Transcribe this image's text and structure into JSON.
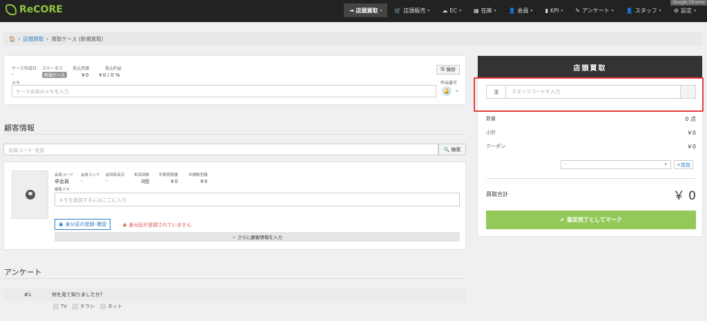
{
  "nav": {
    "brand": "ReCORE",
    "items": [
      {
        "icon": "⇥",
        "label": "店頭買取",
        "active": true
      },
      {
        "icon": "🛒",
        "label": "店頭販売"
      },
      {
        "icon": "☁",
        "label": "EC"
      },
      {
        "icon": "▦",
        "label": "在庫"
      },
      {
        "icon": "👤",
        "label": "会員"
      },
      {
        "icon": "▮",
        "label": "KPI"
      },
      {
        "icon": "✎",
        "label": "アンケート"
      },
      {
        "icon": "👤",
        "label": "スタッフ"
      },
      {
        "icon": "⚙",
        "label": "設定"
      }
    ],
    "chrome_label": "Google Chrome"
  },
  "breadcrumb": {
    "home_icon": "🏠",
    "level1": "店頭買取",
    "level2": "買取ケース (新規買取)"
  },
  "case": {
    "created_label": "ケース作成日",
    "created_value": "-",
    "status_label": "ステータス",
    "status_value": "新規ケース",
    "expected_sales_label": "見込売価",
    "expected_sales_value": "￥0",
    "expected_profit_label": "見込利益",
    "expected_profit_value": "￥0 / 0 %",
    "save_label": "保存",
    "memo_label": "メモ",
    "memo_placeholder": "ケース全体のメモを入力",
    "call_label": "呼出番号",
    "call_value": "–"
  },
  "customer": {
    "section_title": "顧客情報",
    "search_placeholder": "会員コード･名前",
    "search_button": "検索",
    "fields": [
      {
        "label": "会員コード",
        "value": "非会員"
      },
      {
        "label": "会員ランク",
        "value": "-"
      },
      {
        "label": "前回来店日",
        "value": "-"
      },
      {
        "label": "来店回数",
        "value": "0回"
      },
      {
        "label": "年間買取額",
        "value": "￥0"
      },
      {
        "label": "年間販売額",
        "value": "￥0"
      }
    ],
    "memo_label": "顧客メモ",
    "memo_placeholder": "メモを追加するにはここに入力",
    "id_button": "身分証の登録･確認",
    "id_warning": "身分証が登録されていません",
    "more_button": "さらに顧客情報を入力"
  },
  "survey": {
    "section_title": "アンケート",
    "question_num": "#1",
    "question_text": "何を見て知りましたか？",
    "options": [
      "TV",
      "チラシ",
      "ネット"
    ]
  },
  "panel": {
    "title": "店頭買取",
    "staff_placeholder": "スタッフコードを入力",
    "staff_btn": "-",
    "barcode_icon": "||||",
    "qty_label": "数量",
    "qty_value": "0 点",
    "subtotal_label": "小計",
    "subtotal_value": "￥0",
    "coupon_label": "クーポン",
    "coupon_value": "￥0",
    "coupon_select": "-",
    "add_label": "追加",
    "total_label": "買取合計",
    "total_value": "￥ 0",
    "mark_button": "査定完了としてマーク"
  },
  "colors": {
    "accent": "#2a7bc5",
    "brand": "#8cc63f",
    "highlight": "#e83b3b",
    "success": "#94c95a"
  }
}
